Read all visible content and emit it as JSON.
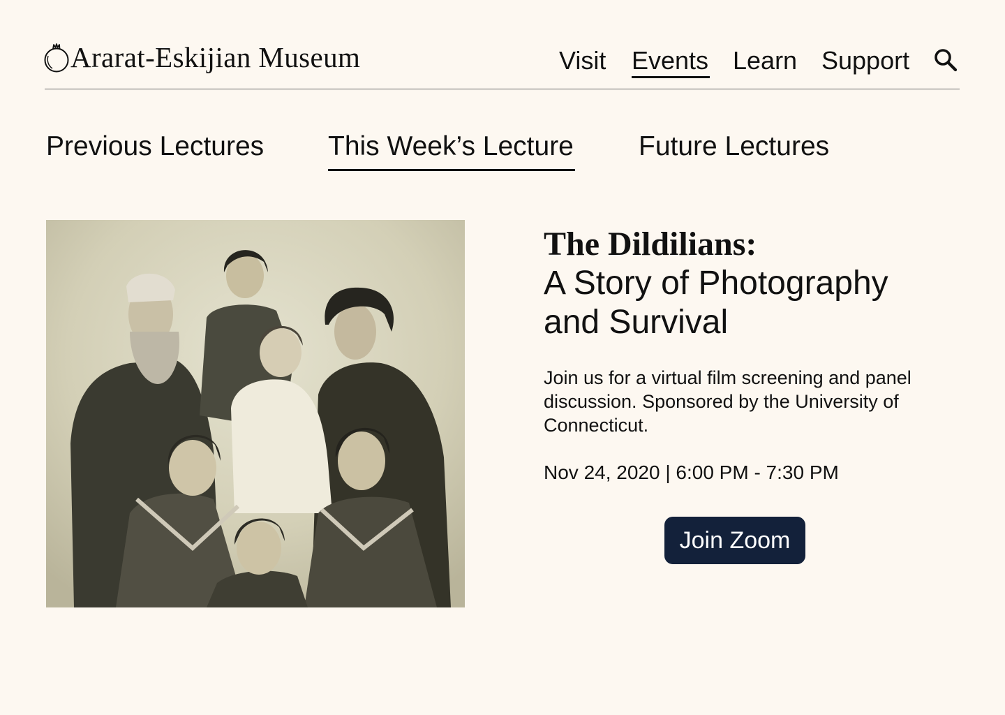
{
  "brand": {
    "name": "Ararat-Eskijian Museum",
    "icon": "pomegranate-icon"
  },
  "nav": {
    "items": [
      {
        "label": "Visit",
        "active": false
      },
      {
        "label": "Events",
        "active": true
      },
      {
        "label": "Learn",
        "active": false
      },
      {
        "label": "Support",
        "active": false
      }
    ],
    "search_icon": "search-icon"
  },
  "tabs": [
    {
      "label": "Previous Lectures",
      "active": false
    },
    {
      "label": "This Week’s Lecture",
      "active": true
    },
    {
      "label": "Future Lectures",
      "active": false
    }
  ],
  "lecture": {
    "title": "The Dildilians:",
    "subtitle": "A Story of Photography and Survival",
    "description": "Join us for a virtual film screening and panel discussion. Sponsored by the University of Connecticut.",
    "datetime": "Nov 24, 2020 | 6:00 PM - 7:30 PM",
    "button_label": "Join Zoom"
  },
  "colors": {
    "background": "#fdf8f1",
    "text": "#111111",
    "button": "#13213a",
    "button_text": "#ffffff"
  }
}
